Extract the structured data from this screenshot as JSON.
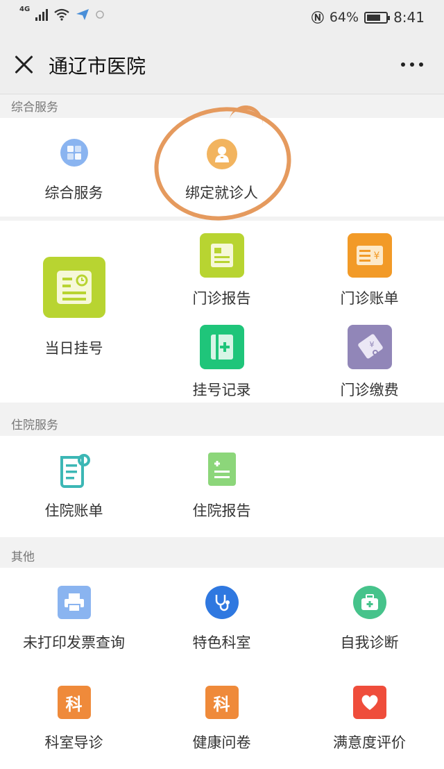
{
  "status_bar": {
    "network": "4G",
    "battery_percent": 64,
    "battery_text": "64%",
    "time": "8:41"
  },
  "nav": {
    "title": "通辽市医院"
  },
  "sections": {
    "general": {
      "header": "综合服务",
      "items": [
        {
          "label": "综合服务",
          "icon": "grid-icon",
          "color": "#8ab4f0"
        },
        {
          "label": "绑定就诊人",
          "icon": "doctor-icon",
          "color": "#f2b45f"
        }
      ]
    },
    "outpatient": {
      "items": [
        {
          "label": "当日挂号",
          "icon": "registration-icon",
          "color": "#b8d431"
        },
        {
          "label": "门诊报告",
          "icon": "report-icon",
          "color": "#b8d431"
        },
        {
          "label": "门诊账单",
          "icon": "bill-icon",
          "color": "#f29a27"
        },
        {
          "label": "挂号记录",
          "icon": "record-icon",
          "color": "#1fc57a"
        },
        {
          "label": "门诊缴费",
          "icon": "payment-icon",
          "color": "#9186b8"
        }
      ]
    },
    "inpatient": {
      "header": "住院服务",
      "items": [
        {
          "label": "住院账单",
          "icon": "scroll-icon",
          "color": "#3cb7b5"
        },
        {
          "label": "住院报告",
          "icon": "document-icon",
          "color": "#8cd67a"
        }
      ]
    },
    "other": {
      "header": "其他",
      "items": [
        {
          "label": "未打印发票查询",
          "icon": "printer-icon",
          "color": "#8ab4f0"
        },
        {
          "label": "特色科室",
          "icon": "stethoscope-icon",
          "color": "#2f78e0"
        },
        {
          "label": "自我诊断",
          "icon": "medkit-icon",
          "color": "#46c38b"
        },
        {
          "label": "科室导诊",
          "icon": "department-icon",
          "color": "#ef8a3a",
          "glyph": "科"
        },
        {
          "label": "健康问卷",
          "icon": "questionnaire-icon",
          "color": "#ef8a3a",
          "glyph": "科"
        },
        {
          "label": "满意度评价",
          "icon": "heart-icon",
          "color": "#ef4d3b"
        }
      ]
    }
  },
  "annotation_color": "#e59a5e"
}
